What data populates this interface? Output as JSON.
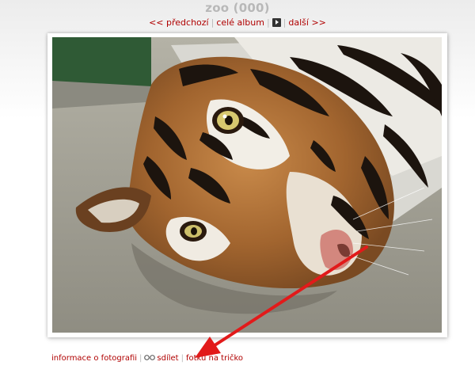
{
  "album_title": "zoo (000)",
  "nav": {
    "prev_label": "<< předchozí",
    "album_label": "celé album",
    "next_label": "další >>",
    "separator": "|",
    "slideshow_icon": "play-icon"
  },
  "photo": {
    "subject": "tiger-photo"
  },
  "bottom_links": {
    "info_label": "informace o fotografii",
    "share_label": "sdílet",
    "share_icon": "share-icon",
    "tshirt_label": "fotku na tričko",
    "separator": "|"
  },
  "colors": {
    "link": "#b00000",
    "separator": "#bbbbbb",
    "title": "#b8b8b8",
    "annotation_arrow": "#e21a1a"
  }
}
